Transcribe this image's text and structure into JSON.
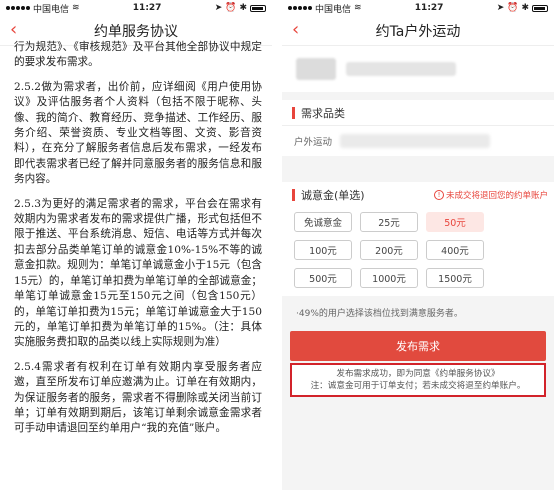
{
  "left": {
    "status": {
      "carrier": "中国电信",
      "time": "11:27"
    },
    "nav": {
      "title": "约单服务协议"
    },
    "doc": {
      "p0": "行为规范》、《审核规范》及平台其他全部协议中规定的要求发布需求。",
      "p1": "2.5.2做为需求者，出价前，应详细阅《用户使用协议》及评估服务者个人资料（包括不限于昵称、头像、我的简介、教育经历、竞争描述、工作经历、服务介绍、荣誉资质、专业文档等图、文资、影音资料），在充分了解服务者信息后发布需求，一经发布即代表需求者已经了解并同意服务者的服务信息和服务内容。",
      "p2": "2.5.3为更好的满足需求者的需求，平台会在需求有效期内为需求者发布的需求提供广播，形式包括但不限于推送、平台系统消息、短信、电话等方式并每次扣去部分品类单笔订单的诚意金10%-15%不等的诚意金扣款。规则为：单笔订单诚意金小于15元（包含15元）的，单笔订单扣费为单笔订单的全部诚意金；单笔订单诚意金15元至150元之间（包含150元）的，单笔订单扣费为15元；单笔订单诚意金大于150元的，单笔订单扣费为单笔订单的15%。（注：具体实施服务费扣取的品类以线上实际规则为准）",
      "p3": "2.5.4需求者有权利在订单有效期内享受服务者应邀，直至所发布订单应邀满为止。订单在有效期内，为保证服务者的服务，需求者不得删除或关闭当前订单；订单有效期到期后，该笔订单剩余诚意金需求者可手动申请退回至约单用户“我的充值”账户。"
    }
  },
  "right": {
    "status": {
      "carrier": "中国电信",
      "time": "11:27"
    },
    "nav": {
      "title": "约Ta户外运动"
    },
    "needs": {
      "title": "需求品类",
      "item_label": "户外运动"
    },
    "deposit": {
      "title": "诚意金(单选)",
      "note": "未成交将退回您的约单账户",
      "options": [
        "免诚意金",
        "25元",
        "50元",
        "100元",
        "200元",
        "400元",
        "500元",
        "1000元",
        "1500元"
      ],
      "selected": "50元"
    },
    "hint": "·49%的用户选择该档位找到满意服务者。",
    "submit_label": "发布需求",
    "notice_line1": "发布需求成功，即为同意《约单服务协议》",
    "notice_line2": "注：诚意金可用于订单支付；若未成交将退至约单账户。",
    "accent": "#e8453c"
  }
}
